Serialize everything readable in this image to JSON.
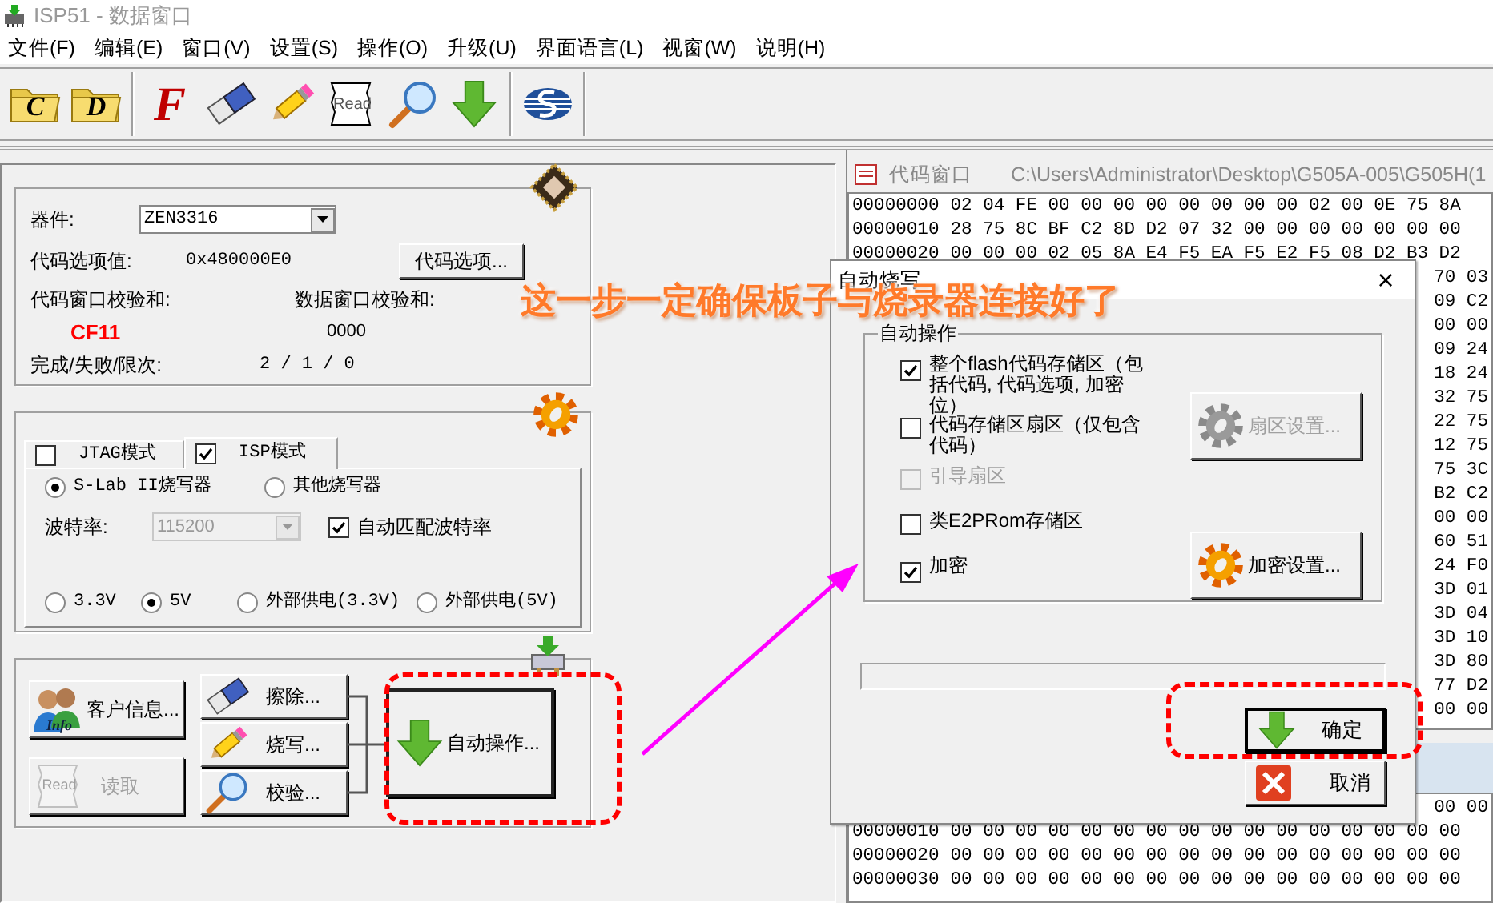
{
  "window": {
    "title": "ISP51 - 数据窗口"
  },
  "menu": [
    "文件(F)",
    "编辑(E)",
    "窗口(V)",
    "设置(S)",
    "操作(O)",
    "升级(U)",
    "界面语言(L)",
    "视窗(W)",
    "说明(H)"
  ],
  "toolbar": [
    {
      "kind": "folder",
      "label": "C"
    },
    {
      "kind": "folder",
      "label": "D"
    },
    {
      "kind": "separator"
    },
    {
      "kind": "letter",
      "label": "F"
    },
    {
      "kind": "eraser"
    },
    {
      "kind": "pencil"
    },
    {
      "kind": "scroll",
      "label": "Read"
    },
    {
      "kind": "magnifier"
    },
    {
      "kind": "arrow"
    },
    {
      "kind": "separator"
    },
    {
      "kind": "logo"
    },
    {
      "kind": "separator"
    }
  ],
  "device_panel": {
    "device_label": "器件:",
    "device": "ZEN3316",
    "option_label": "代码选项值:",
    "option_value": "0x480000E0",
    "option_button": "代码选项...",
    "code_checksum_label": "代码窗口校验和:",
    "code_checksum": "CF11",
    "data_checksum_label": "数据窗口校验和:",
    "data_checksum": "0000",
    "count_label": "完成/失败/限次:",
    "count": "2 / 1 / 0"
  },
  "mode_panel": {
    "tabs": [
      {
        "label": "JTAG模式",
        "checked": false,
        "selected": false
      },
      {
        "label": "ISP模式",
        "checked": true,
        "selected": true
      }
    ],
    "programmers": [
      {
        "label": "S-Lab II烧写器",
        "selected": true
      },
      {
        "label": "其他烧写器",
        "selected": false
      }
    ],
    "baud_label": "波特率:",
    "baud": {
      "value": "115200",
      "disabled": true
    },
    "auto_baud": {
      "label": "自动匹配波特率",
      "checked": true
    },
    "voltages": [
      {
        "label": "3.3V",
        "selected": false
      },
      {
        "label": "5V",
        "selected": true
      },
      {
        "label": "外部供电(3.3V)",
        "selected": false
      },
      {
        "label": "外部供电(5V)",
        "selected": false
      }
    ]
  },
  "actions": {
    "customer_info": {
      "label": "客户信息...",
      "icon_text": "Info",
      "disabled": false
    },
    "read": {
      "label": "读取",
      "icon_text": "Read",
      "disabled": true
    },
    "steps": [
      {
        "kind": "eraser",
        "label": "擦除..."
      },
      {
        "kind": "pencil",
        "label": "烧写..."
      },
      {
        "kind": "magnifier",
        "label": "校验..."
      }
    ],
    "auto": {
      "label": "自动操作..."
    }
  },
  "code_window": {
    "title": "代码窗口",
    "path": "C:\\Users\\Administrator\\Desktop\\G505A-005\\G505H(1",
    "rows": [
      {
        "address": "00000000",
        "bytes": [
          "02",
          "04",
          "FE",
          "00",
          "00",
          "00",
          "00",
          "00",
          "00",
          "00",
          "00",
          "02",
          "00",
          "0E",
          "75",
          "8A"
        ]
      },
      {
        "address": "00000010",
        "bytes": [
          "28",
          "75",
          "8C",
          "BF",
          "C2",
          "8D",
          "D2",
          "07",
          "32",
          "00",
          "00",
          "00",
          "00",
          "00",
          "00",
          "00"
        ]
      },
      {
        "address": "00000020",
        "bytes": [
          "00",
          "00",
          "00",
          "02",
          "05",
          "8A",
          "E4",
          "F5",
          "EA",
          "F5",
          "E2",
          "F5",
          "08",
          "D2",
          "B3",
          "D2"
        ]
      },
      {
        "bytes": [
          "70",
          "03"
        ]
      },
      {
        "bytes": [
          "09",
          "C2"
        ]
      },
      {
        "bytes": [
          "00",
          "00"
        ]
      },
      {
        "bytes": [
          "09",
          "24"
        ]
      },
      {
        "bytes": [
          "18",
          "24"
        ]
      },
      {
        "bytes": [
          "32",
          "75"
        ]
      },
      {
        "bytes": [
          "22",
          "75"
        ]
      },
      {
        "bytes": [
          "12",
          "75"
        ]
      },
      {
        "bytes": [
          "75",
          "3C"
        ]
      },
      {
        "bytes": [
          "B2",
          "C2"
        ]
      },
      {
        "bytes": [
          "00",
          "00"
        ]
      },
      {
        "bytes": [
          "60",
          "51"
        ]
      },
      {
        "bytes": [
          "24",
          "F0"
        ]
      },
      {
        "bytes": [
          "3D",
          "01"
        ]
      },
      {
        "bytes": [
          "3D",
          "04"
        ]
      },
      {
        "bytes": [
          "3D",
          "10"
        ]
      },
      {
        "bytes": [
          "3D",
          "80"
        ]
      },
      {
        "bytes": [
          "77",
          "D2"
        ]
      },
      {
        "bytes": [
          "00",
          "00"
        ]
      }
    ]
  },
  "data_window": {
    "rows": [
      {
        "bytes": [
          "00",
          "00"
        ]
      },
      {
        "address": "00000010",
        "bytes": [
          "00",
          "00",
          "00",
          "00",
          "00",
          "00",
          "00",
          "00",
          "00",
          "00",
          "00",
          "00",
          "00",
          "00",
          "00",
          "00"
        ]
      },
      {
        "address": "00000020",
        "bytes": [
          "00",
          "00",
          "00",
          "00",
          "00",
          "00",
          "00",
          "00",
          "00",
          "00",
          "00",
          "00",
          "00",
          "00",
          "00",
          "00"
        ]
      },
      {
        "address": "00000030",
        "bytes": [
          "00",
          "00",
          "00",
          "00",
          "00",
          "00",
          "00",
          "00",
          "00",
          "00",
          "00",
          "00",
          "00",
          "00",
          "00",
          "00"
        ]
      }
    ]
  },
  "dialog": {
    "title": "自动烧写",
    "close": "×",
    "group": "自动操作",
    "options": [
      {
        "label": "整个flash代码存储区（包括代码, 代码选项, 加密位）",
        "checked": true,
        "disabled": false
      },
      {
        "label": "代码存储区扇区（仅包含代码）",
        "checked": false,
        "disabled": false
      },
      {
        "label": "引导扇区",
        "checked": false,
        "disabled": true
      },
      {
        "label": "类E2PRom存储区",
        "checked": false,
        "disabled": false
      },
      {
        "label": "加密",
        "checked": true,
        "disabled": false
      }
    ],
    "sector_button": {
      "label": "扇区设置...",
      "disabled": true
    },
    "encrypt_button": {
      "label": "加密设置...",
      "disabled": false
    },
    "progress": {
      "level": 0
    },
    "ok": "确定",
    "cancel": "取消"
  },
  "annotation": {
    "text": "这一步一定确保板子与烧录器连接好了"
  }
}
